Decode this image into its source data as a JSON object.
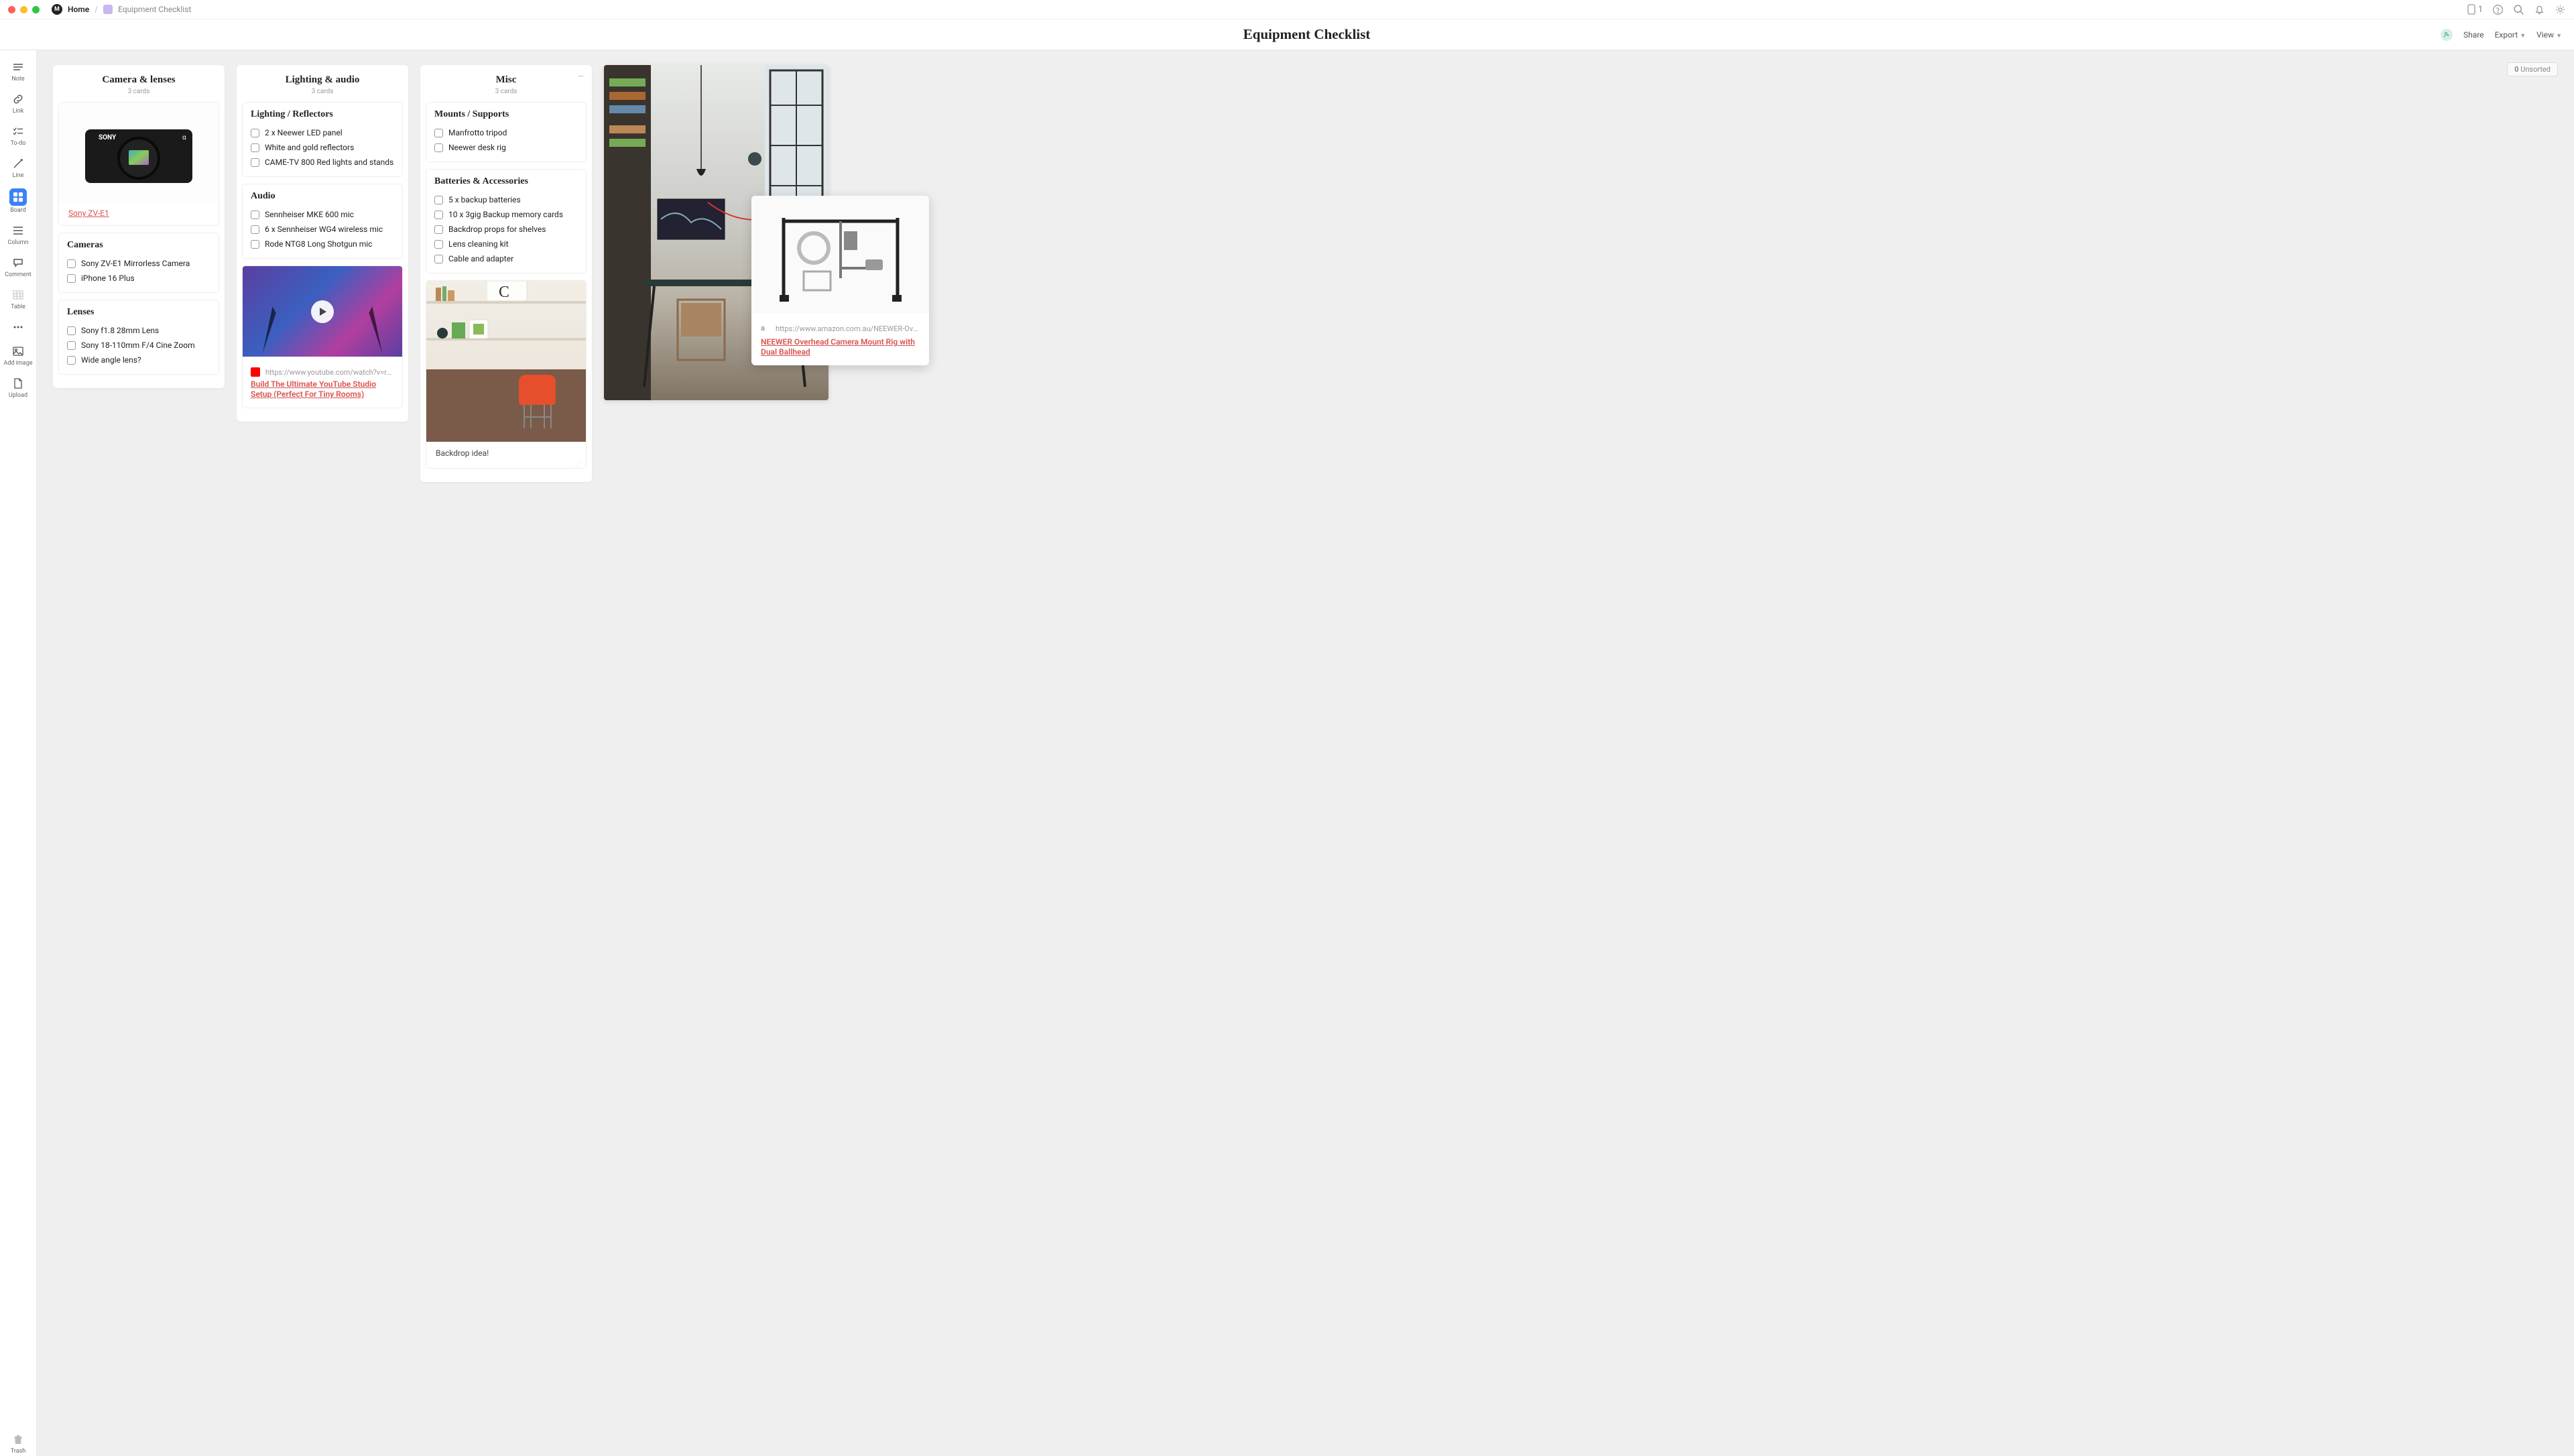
{
  "titlebar": {
    "home_label": "Home",
    "page_label": "Equipment Checklist",
    "device_count": "1"
  },
  "header": {
    "title": "Equipment Checklist",
    "share_label": "Share",
    "export_label": "Export",
    "view_label": "View"
  },
  "sidebar": {
    "items": [
      {
        "label": "Note"
      },
      {
        "label": "Link"
      },
      {
        "label": "To-do"
      },
      {
        "label": "Line"
      },
      {
        "label": "Board"
      },
      {
        "label": "Column"
      },
      {
        "label": "Comment"
      },
      {
        "label": "Table"
      },
      {
        "label": ""
      },
      {
        "label": "Add image"
      },
      {
        "label": "Upload"
      }
    ],
    "trash_label": "Trash"
  },
  "unsorted": {
    "count": "0",
    "label": "Unsorted"
  },
  "columns": [
    {
      "title": "Camera & lenses",
      "meta": "3 cards",
      "cards": [
        {
          "type": "image_link",
          "link_text": "Sony ZV-E1"
        },
        {
          "type": "checklist",
          "heading": "Cameras",
          "items": [
            "Sony ZV-E1 Mirrorless Camera",
            "iPhone 16 Plus"
          ]
        },
        {
          "type": "checklist",
          "heading": "Lenses",
          "items": [
            "Sony f1.8 28mm Lens",
            "Sony 18-110mm F/4 Cine Zoom",
            "Wide angle lens?"
          ]
        }
      ]
    },
    {
      "title": "Lighting & audio",
      "meta": "3 cards",
      "cards": [
        {
          "type": "checklist",
          "heading": "Lighting / Reflectors",
          "items": [
            "2 x Neewer LED panel",
            "White and gold reflectors",
            "CAME-TV 800 Red lights and stands"
          ]
        },
        {
          "type": "checklist",
          "heading": "Audio",
          "items": [
            "Sennheiser MKE 600 mic",
            "6 x Sennheiser WG4 wireless mic",
            "Rode NTG8 Long Shotgun mic"
          ]
        },
        {
          "type": "video_link",
          "url": "https://www.youtube.com/watch?v=rMiJ30",
          "title": "Build The Ultimate YouTube Studio Setup (Perfect For Tiny Rooms)"
        }
      ]
    },
    {
      "title": "Misc",
      "meta": "3 cards",
      "cards": [
        {
          "type": "checklist",
          "heading": "Mounts / Supports",
          "items": [
            "Manfrotto tripod",
            "Neewer desk rig"
          ]
        },
        {
          "type": "checklist",
          "heading": "Batteries  & Accessories",
          "items": [
            "5 x backup batteries",
            "10 x 3gig Backup memory cards",
            "Backdrop props for shelves",
            "Lens cleaning kit",
            "Cable and adapter"
          ]
        },
        {
          "type": "image_caption",
          "caption": "Backdrop idea!"
        }
      ]
    }
  ],
  "float_card": {
    "url": "https://www.amazon.com.au/NEEWER-Overhea",
    "title": "NEEWER Overhead Camera Mount Rig with Dual Ballhead"
  }
}
